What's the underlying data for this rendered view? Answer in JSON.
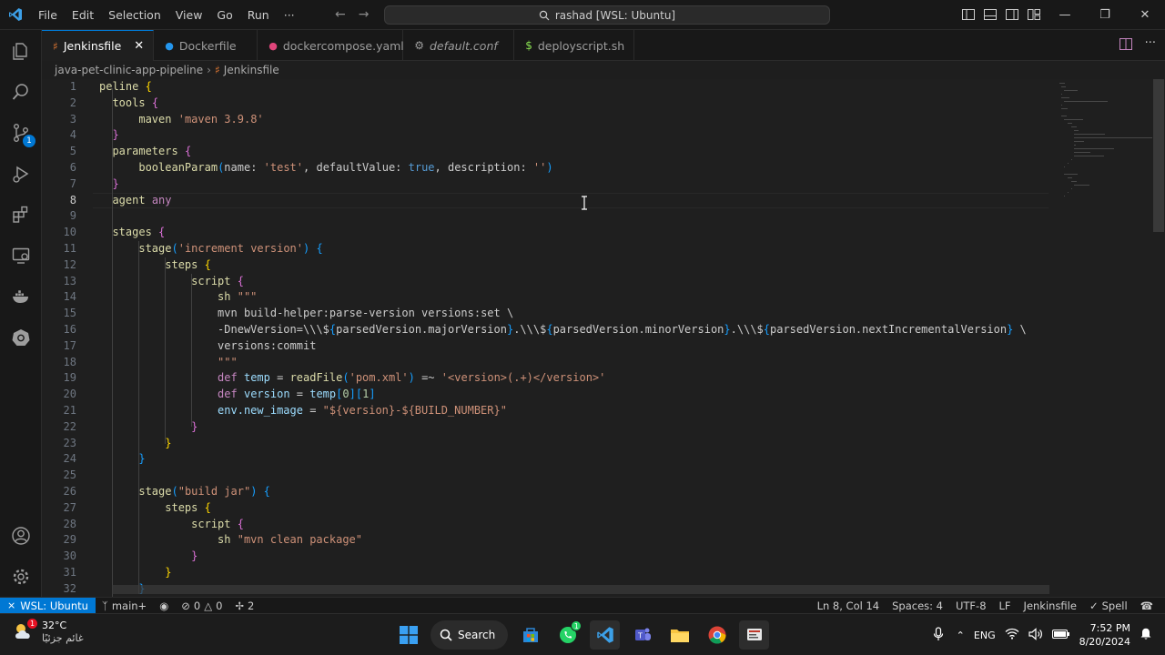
{
  "window": {
    "menu": [
      "File",
      "Edit",
      "Selection",
      "View",
      "Go",
      "Run",
      "···"
    ],
    "command_center": "rashad [WSL: Ubuntu]"
  },
  "activity_bar": {
    "source_control_badge": "1"
  },
  "tabs": [
    {
      "label": "Jenkinsfile",
      "active": true,
      "italic": false
    },
    {
      "label": "Dockerfile",
      "active": false,
      "italic": false
    },
    {
      "label": "dockercompose.yaml",
      "active": false,
      "italic": false
    },
    {
      "label": "default.conf",
      "active": false,
      "italic": true
    },
    {
      "label": "deployscript.sh",
      "active": false,
      "italic": false
    }
  ],
  "breadcrumb": {
    "folder": "java-pet-clinic-app-pipeline",
    "file": "Jenkinsfile"
  },
  "editor": {
    "current_line": 8,
    "lines": [
      {
        "n": "1",
        "t": "peline {"
      },
      {
        "n": "2",
        "t": "  tools {"
      },
      {
        "n": "3",
        "t": "      maven 'maven 3.9.8'"
      },
      {
        "n": "4",
        "t": "  }"
      },
      {
        "n": "5",
        "t": "  parameters {"
      },
      {
        "n": "6",
        "t": "      booleanParam(name: 'test', defaultValue: true, description: '')"
      },
      {
        "n": "7",
        "t": "  }"
      },
      {
        "n": "8",
        "t": "  agent any"
      },
      {
        "n": "9",
        "t": ""
      },
      {
        "n": "10",
        "t": "  stages {"
      },
      {
        "n": "11",
        "t": "      stage('increment version') {"
      },
      {
        "n": "12",
        "t": "          steps {"
      },
      {
        "n": "13",
        "t": "              script {"
      },
      {
        "n": "14",
        "t": "                  sh \"\"\""
      },
      {
        "n": "15",
        "t": "                  mvn build-helper:parse-version versions:set \\"
      },
      {
        "n": "16",
        "t": "                  -DnewVersion=\\\\\\${parsedVersion.majorVersion}.\\\\\\${parsedVersion.minorVersion}.\\\\\\${parsedVersion.nextIncrementalVersion} \\"
      },
      {
        "n": "17",
        "t": "                  versions:commit"
      },
      {
        "n": "18",
        "t": "                  \"\"\""
      },
      {
        "n": "19",
        "t": "                  def temp = readFile('pom.xml') =~ '<version>(.+)</version>'"
      },
      {
        "n": "20",
        "t": "                  def version = temp[0][1]"
      },
      {
        "n": "21",
        "t": "                  env.new_image = \"${version}-${BUILD_NUMBER}\""
      },
      {
        "n": "22",
        "t": "              }"
      },
      {
        "n": "23",
        "t": "          }"
      },
      {
        "n": "24",
        "t": "      }"
      },
      {
        "n": "25",
        "t": ""
      },
      {
        "n": "26",
        "t": "      stage(\"build jar\") {"
      },
      {
        "n": "27",
        "t": "          steps {"
      },
      {
        "n": "28",
        "t": "              script {"
      },
      {
        "n": "29",
        "t": "                  sh \"mvn clean package\""
      },
      {
        "n": "30",
        "t": "              }"
      },
      {
        "n": "31",
        "t": "          }"
      },
      {
        "n": "32",
        "t": "      }"
      }
    ]
  },
  "status_bar": {
    "remote": "WSL: Ubuntu",
    "branch": "main+",
    "errors": "0",
    "warnings": "0",
    "ports": "2",
    "position": "Ln 8, Col 14",
    "spaces": "Spaces: 4",
    "encoding": "UTF-8",
    "eol": "LF",
    "language": "Jenkinsfile",
    "spell": "Spell"
  },
  "taskbar": {
    "weather_temp": "32°C",
    "weather_desc": "غائم جزئيًا",
    "weather_badge": "1",
    "search_label": "Search",
    "whatsapp_badge": "1",
    "language": "ENG",
    "time": "7:52 PM",
    "date": "8/20/2024"
  }
}
